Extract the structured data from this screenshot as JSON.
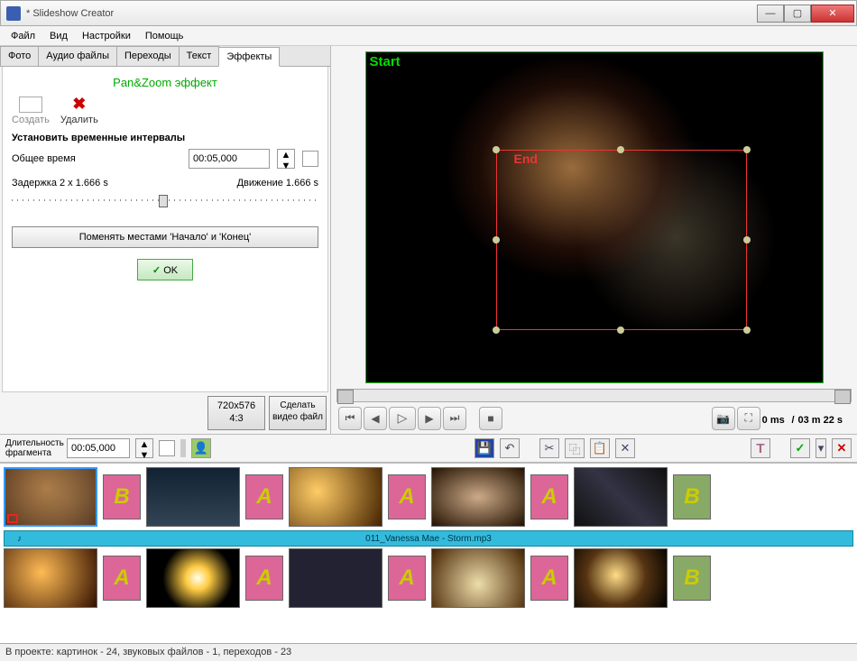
{
  "window": {
    "title": "* Slideshow Creator"
  },
  "menu": {
    "file": "Файл",
    "view": "Вид",
    "settings": "Настройки",
    "help": "Помощь"
  },
  "tabs": {
    "photo": "Фото",
    "audio": "Аудио файлы",
    "transitions": "Переходы",
    "text": "Текст",
    "effects": "Эффекты"
  },
  "panzoom": {
    "title": "Pan&Zoom эффект",
    "create": "Создать",
    "delete": "Удалить",
    "intervals_header": "Установить временные интервалы",
    "total_time_label": "Общее время",
    "total_time_value": "00:05,000",
    "delay_label": "Задержка 2 x 1.666 s",
    "motion_label": "Движение 1.666 s",
    "swap_btn": "Поменять местами 'Начало' и 'Конец'",
    "ok": "OK"
  },
  "resbtn": {
    "res": "720x576",
    "ratio": "4:3"
  },
  "makevideo": "Сделать видео файл",
  "preview": {
    "start": "Start",
    "end": "End"
  },
  "playback": {
    "pos": "0 ms",
    "sep": "/",
    "dur": "03 m 22 s"
  },
  "fragment": {
    "label": "Длительность фрагмента",
    "value": "00:05,000"
  },
  "audio_track": "011_Vanessa Mae - Storm.mp3",
  "timeline": {
    "row1_trans": [
      "B",
      "A",
      "A",
      "A",
      "B"
    ],
    "row2_trans": [
      "A",
      "A",
      "A",
      "A",
      "B"
    ]
  },
  "status": "В проекте: картинок - 24, звуковых файлов - 1, переходов - 23"
}
